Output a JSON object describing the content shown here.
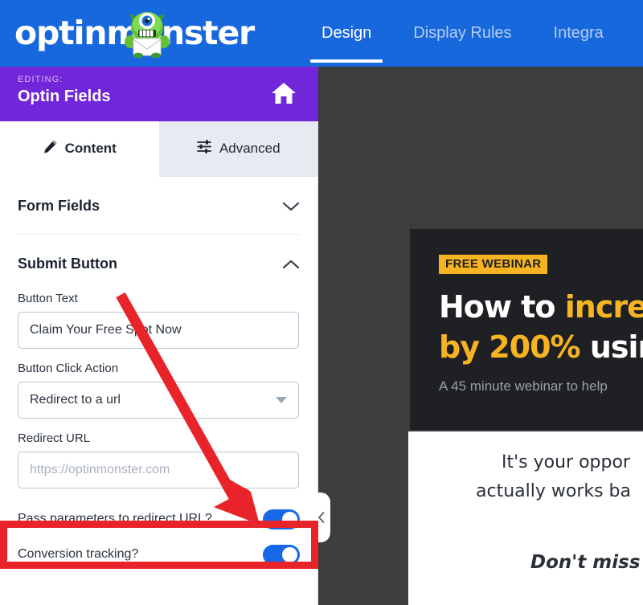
{
  "topnav": {
    "logo_text": "optinmonster",
    "logo_icon": "monster-mascot-icon",
    "tabs": [
      {
        "label": "Design",
        "active": true
      },
      {
        "label": "Display Rules",
        "active": false
      },
      {
        "label": "Integra",
        "active": false
      }
    ]
  },
  "editbar": {
    "eyebrow": "EDITING:",
    "title": "Optin Fields",
    "home_icon": "home-icon"
  },
  "panel_tabs": [
    {
      "label": "Content",
      "icon": "pencil-icon",
      "active": true
    },
    {
      "label": "Advanced",
      "icon": "sliders-icon",
      "active": false
    }
  ],
  "accordions": [
    {
      "title": "Form Fields",
      "state": "collapsed",
      "icon": "chevron-down-icon"
    },
    {
      "title": "Submit Button",
      "state": "expanded",
      "icon": "chevron-up-icon"
    }
  ],
  "fields": {
    "button_text": {
      "label": "Button Text",
      "value": "Claim Your Free Spot Now"
    },
    "button_click_action": {
      "label": "Button Click Action",
      "value": "Redirect to a url",
      "icon": "caret-down-icon"
    },
    "redirect_url": {
      "label": "Redirect URL",
      "value": "",
      "placeholder": "https://optinmonster.com"
    }
  },
  "toggles": [
    {
      "label": "Pass parameters to redirect URL?",
      "state": "on"
    },
    {
      "label": "Conversion tracking?",
      "state": "on"
    }
  ],
  "preview": {
    "badge": "FREE WEBINAR",
    "headline_line1_part1": "How to ",
    "headline_line1_part2": "incre",
    "headline_line2_part1": "by 200% ",
    "headline_line2_part2": "usin",
    "subhead": "A 45 minute webinar to help",
    "body_line1": "It's your oppor",
    "body_line2": "actually works ba",
    "body_line3": "Don't miss"
  },
  "collapse_handle": {
    "icon": "chevron-left-icon"
  },
  "annotations": {
    "arrow": {
      "color": "#e8232a",
      "name": "red-arrow-annotation"
    },
    "highlight_box": {
      "color": "#e8232a",
      "name": "red-highlight-box-annotation"
    }
  },
  "colors": {
    "brand_blue": "#1668dc",
    "editing_purple": "#7126d9",
    "accent_yellow": "#f7b422",
    "annotation_red": "#e8232a",
    "toggle_on": "#1668e8",
    "preview_backdrop": "#3d3d3d",
    "popup_dark": "#1f2023"
  }
}
